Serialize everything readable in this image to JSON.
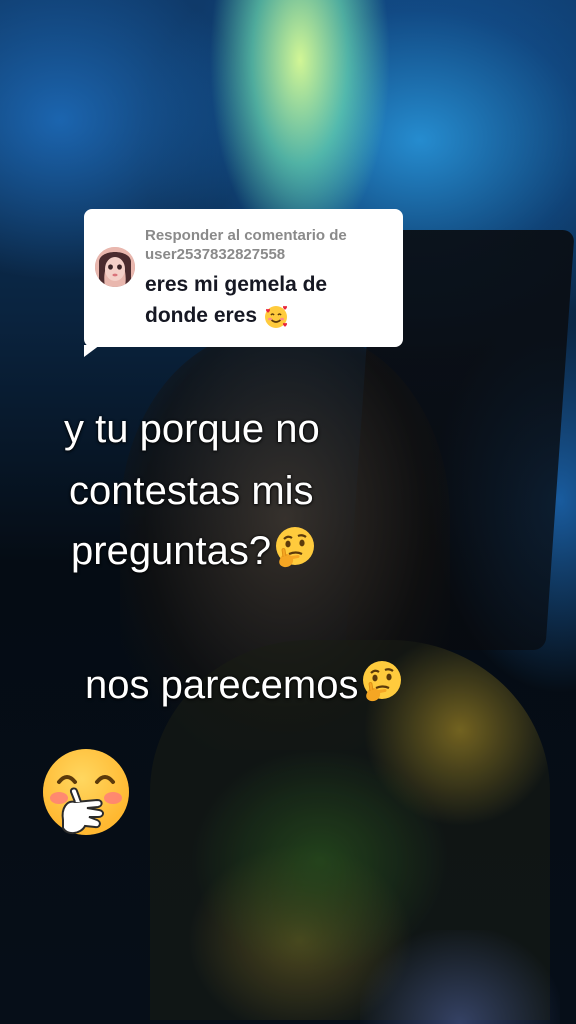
{
  "reply": {
    "header": "Responder al comentario de user2537832827558",
    "comment": "eres mi gemela de donde eres",
    "comment_emoji": "smiling-face-with-hearts-icon"
  },
  "caption": {
    "line1": "y tu porque no",
    "line2": "contestas mis",
    "line3": "preguntas?",
    "line3_emoji": "thinking-face-icon",
    "line4": "nos parecemos",
    "line4_emoji": "thinking-face-icon",
    "sticker_emoji": "face-with-hand-over-mouth-icon"
  },
  "colors": {
    "card_bg": "#ffffff",
    "card_header": "#8a8a8a",
    "card_text": "#161823",
    "caption_text": "#ffffff"
  }
}
